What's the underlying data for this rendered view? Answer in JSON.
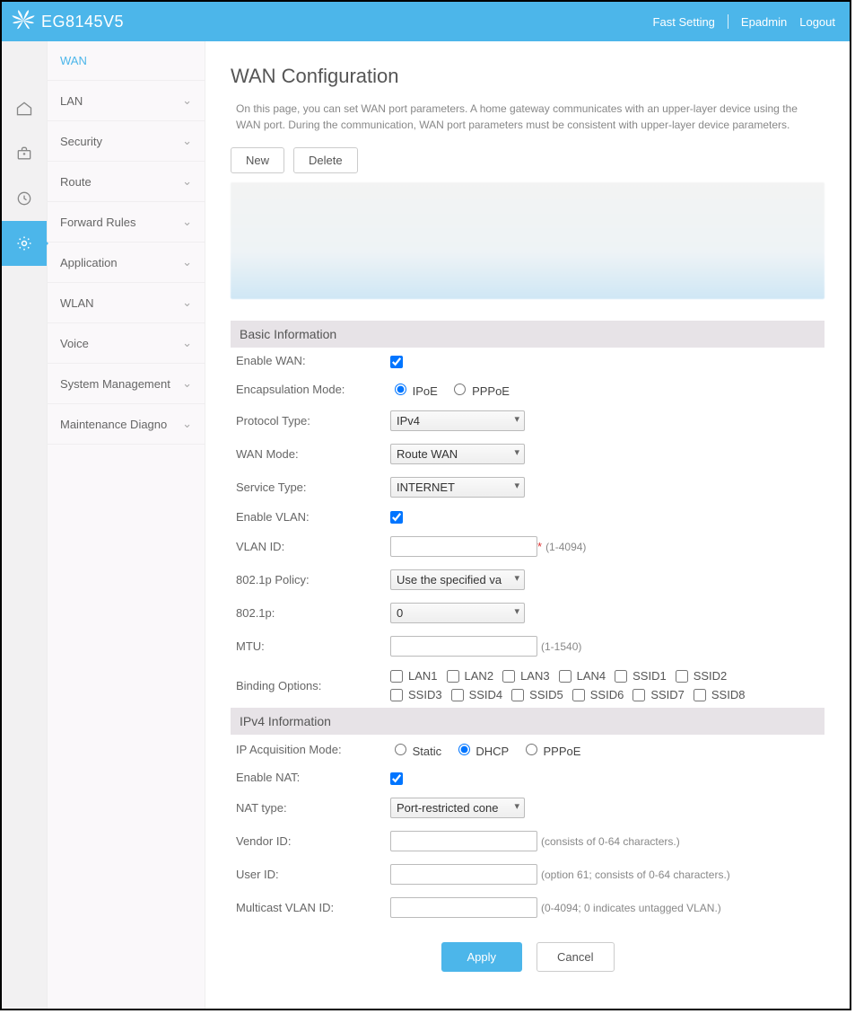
{
  "header": {
    "product": "EG8145V5",
    "links": {
      "fast": "Fast Setting",
      "user": "Epadmin",
      "logout": "Logout"
    }
  },
  "sidenav": {
    "items": [
      {
        "label": "WAN",
        "active": true,
        "expandable": false
      },
      {
        "label": "LAN",
        "expandable": true
      },
      {
        "label": "Security",
        "expandable": true
      },
      {
        "label": "Route",
        "expandable": true
      },
      {
        "label": "Forward Rules",
        "expandable": true
      },
      {
        "label": "Application",
        "expandable": true
      },
      {
        "label": "WLAN",
        "expandable": true
      },
      {
        "label": "Voice",
        "expandable": true
      },
      {
        "label": "System Management",
        "expandable": true
      },
      {
        "label": "Maintenance Diagno",
        "expandable": true
      }
    ]
  },
  "page": {
    "title": "WAN Configuration",
    "intro": "On this page, you can set WAN port parameters. A home gateway communicates with an upper-layer device using the WAN port. During the communication, WAN port parameters must be consistent with upper-layer device parameters.",
    "buttons": {
      "new": "New",
      "delete": "Delete",
      "apply": "Apply",
      "cancel": "Cancel"
    }
  },
  "sections": {
    "basic": {
      "header": "Basic Information",
      "enable_wan": {
        "label": "Enable WAN:",
        "checked": true
      },
      "encap": {
        "label": "Encapsulation Mode:",
        "options": [
          "IPoE",
          "PPPoE"
        ],
        "selected": "IPoE"
      },
      "protocol": {
        "label": "Protocol Type:",
        "value": "IPv4"
      },
      "wan_mode": {
        "label": "WAN Mode:",
        "value": "Route WAN"
      },
      "service_type": {
        "label": "Service Type:",
        "value": "INTERNET"
      },
      "enable_vlan": {
        "label": "Enable VLAN:",
        "checked": true
      },
      "vlan_id": {
        "label": "VLAN ID:",
        "value": "",
        "hint": "(1-4094)",
        "required": true
      },
      "policy": {
        "label": "802.1p Policy:",
        "value": "Use the specified va"
      },
      "p8021": {
        "label": "802.1p:",
        "value": "0"
      },
      "mtu": {
        "label": "MTU:",
        "value": "",
        "hint": "(1-1540)"
      },
      "binding": {
        "label": "Binding Options:",
        "options": [
          "LAN1",
          "LAN2",
          "LAN3",
          "LAN4",
          "SSID1",
          "SSID2",
          "SSID3",
          "SSID4",
          "SSID5",
          "SSID6",
          "SSID7",
          "SSID8"
        ]
      }
    },
    "ipv4": {
      "header": "IPv4 Information",
      "ip_mode": {
        "label": "IP Acquisition Mode:",
        "options": [
          "Static",
          "DHCP",
          "PPPoE"
        ],
        "selected": "DHCP"
      },
      "enable_nat": {
        "label": "Enable NAT:",
        "checked": true
      },
      "nat_type": {
        "label": "NAT type:",
        "value": "Port-restricted cone"
      },
      "vendor_id": {
        "label": "Vendor ID:",
        "value": "",
        "hint": "(consists of 0-64 characters.)"
      },
      "user_id": {
        "label": "User ID:",
        "value": "",
        "hint": "(option 61; consists of 0-64 characters.)"
      },
      "mcast_vlan": {
        "label": "Multicast VLAN ID:",
        "value": "",
        "hint": "(0-4094; 0 indicates untagged VLAN.)"
      }
    }
  }
}
